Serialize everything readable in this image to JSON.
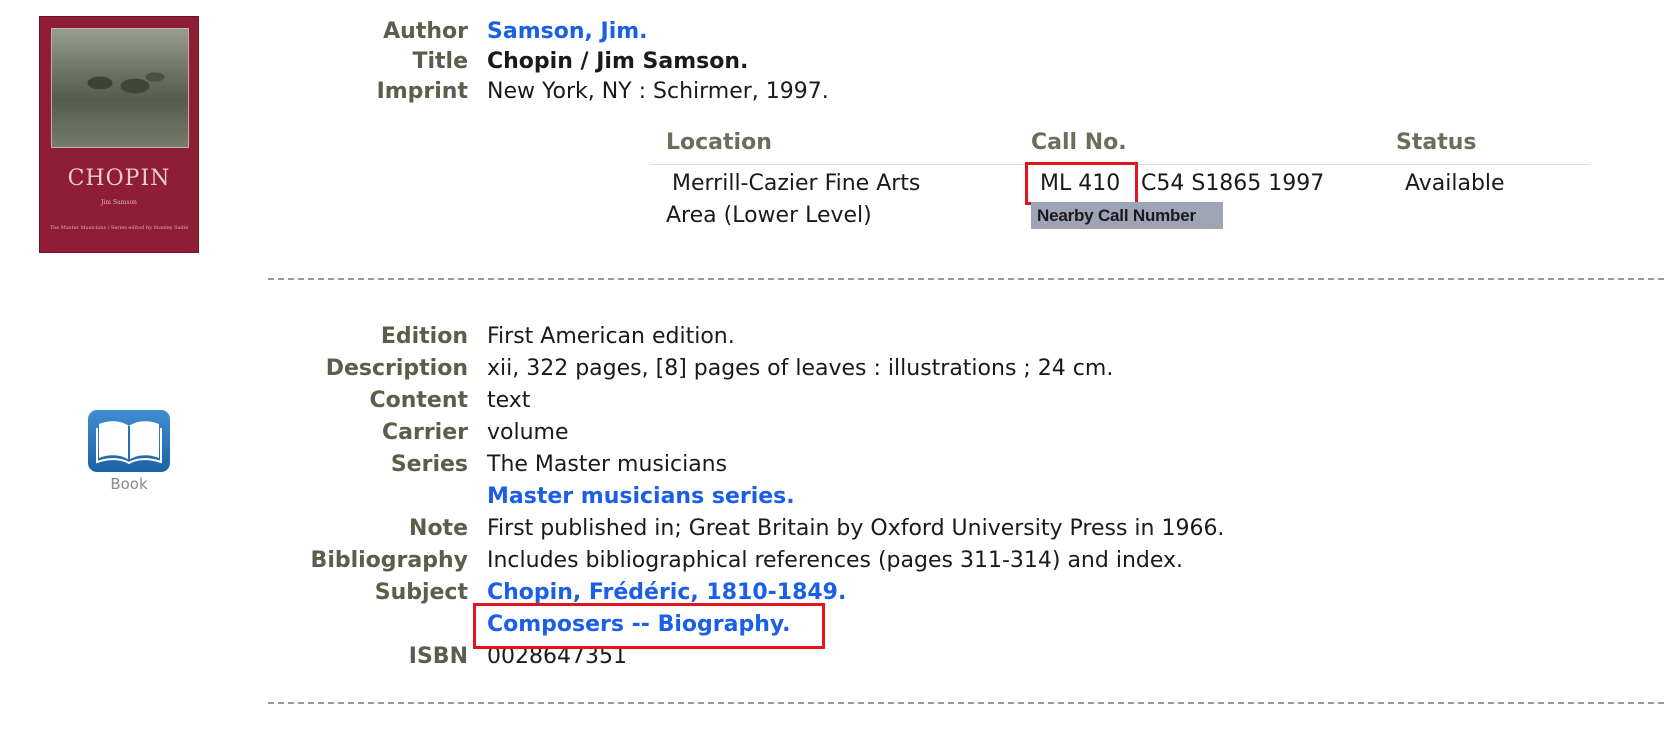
{
  "cover": {
    "title": "CHOPIN",
    "author": "Jim Samson",
    "series": "The Master Musicians / Series edited by Stanley Sadie"
  },
  "format": {
    "icon": "open-book-icon",
    "label": "Book"
  },
  "fields_top": [
    {
      "label": "Author",
      "value": "Samson, Jim.",
      "style": "link"
    },
    {
      "label": "Title",
      "value": "Chopin / Jim Samson.",
      "style": "bold"
    },
    {
      "label": "Imprint",
      "value": "New York, NY : Schirmer, 1997.",
      "style": "plain"
    }
  ],
  "holdings": {
    "headers": {
      "location": "Location",
      "call_no": "Call No.",
      "status": "Status"
    },
    "location_line1": "Merrill-Cazier Fine Arts",
    "location_line2": "Area (Lower Level)",
    "call_no_prefix": "ML 410",
    "call_no_rest": "C54 S1865 1997",
    "status": "Available",
    "nearby_label": "Nearby Call Number"
  },
  "fields_detail": {
    "edition": {
      "label": "Edition",
      "value": "First American edition."
    },
    "description": {
      "label": "Description",
      "value": "xii, 322 pages, [8] pages of leaves : illustrations ; 24 cm."
    },
    "content": {
      "label": "Content",
      "value": "text"
    },
    "carrier": {
      "label": "Carrier",
      "value": "volume"
    },
    "series": {
      "label": "Series",
      "value": "The Master musicians",
      "link": "Master musicians series."
    },
    "note": {
      "label": "Note",
      "value": "First published in; Great Britain by Oxford University Press in 1966."
    },
    "bibliography": {
      "label": "Bibliography",
      "value": "Includes bibliographical references (pages 311-314) and index."
    },
    "subject": {
      "label": "Subject",
      "link1": "Chopin, Frédéric, 1810-1849.",
      "link2": "Composers -- Biography."
    },
    "isbn": {
      "label": "ISBN",
      "value": "0028647351"
    }
  },
  "colors": {
    "link": "#1a5fe6",
    "label": "#5a5e4a",
    "highlight_box": "#e3141d",
    "cover": "#8e1d35"
  }
}
